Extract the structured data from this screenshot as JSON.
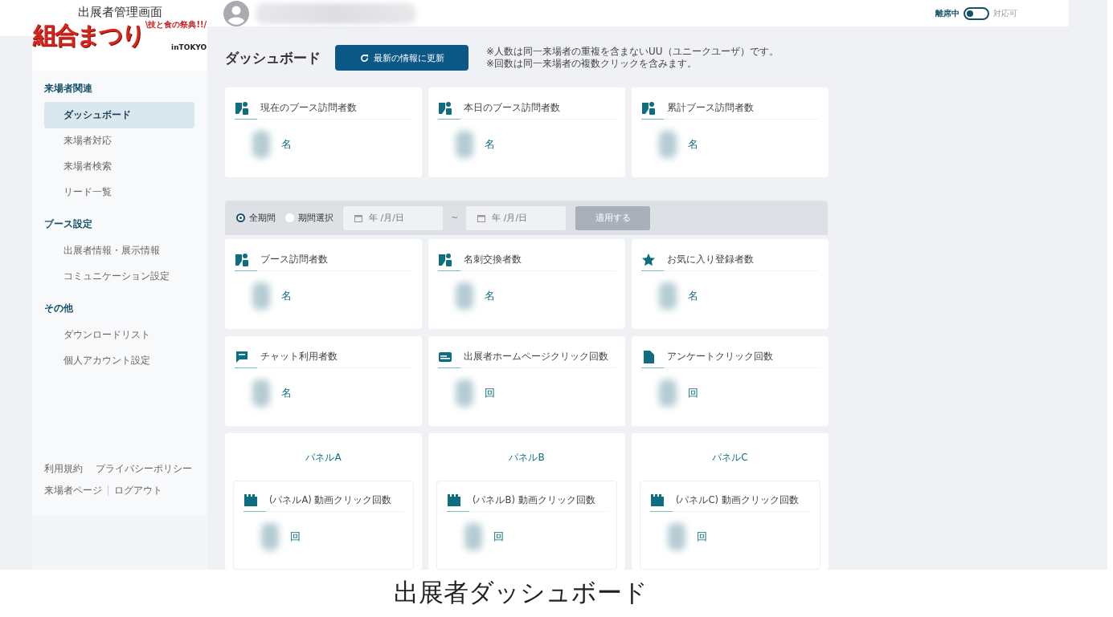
{
  "logo": {
    "caption": "出展者管理画面",
    "title": "組合まつり",
    "tagline": "\\技と食の祭典!!/",
    "subtitle": "inTOKYO"
  },
  "status_toggle": {
    "label_left": "離席中",
    "label_right": "対応可",
    "on": false
  },
  "sidebar": {
    "sections": [
      {
        "title": "来場者関連",
        "items": [
          {
            "label": "ダッシュボード",
            "selected": true
          },
          {
            "label": "来場者対応",
            "selected": false
          },
          {
            "label": "来場者検索",
            "selected": false
          },
          {
            "label": "リード一覧",
            "selected": false
          }
        ]
      },
      {
        "title": "ブース設定",
        "items": [
          {
            "label": "出展者情報・展示情報",
            "selected": false
          },
          {
            "label": "コミュニケーション設定",
            "selected": false
          }
        ]
      },
      {
        "title": "その他",
        "items": [
          {
            "label": "ダウンロードリスト",
            "selected": false
          },
          {
            "label": "個人アカウント設定",
            "selected": false
          }
        ]
      }
    ],
    "footer_rows": [
      {
        "links": [
          "利用規約",
          "プライバシーポリシー"
        ],
        "divider": false
      },
      {
        "links": [
          "来場者ページ",
          "ログアウト"
        ],
        "divider": true
      }
    ]
  },
  "page": {
    "title": "ダッシュボード",
    "refresh_button": "最新の情報に更新",
    "notes": [
      "※人数は同一来場者の重複を含まないUU（ユニークユーザ）です。",
      "※回数は同一来場者の複数クリックを含みます。"
    ]
  },
  "summary_cards": [
    {
      "kind": "visitors",
      "label": "現在のブース訪問者数",
      "unit": "名"
    },
    {
      "kind": "visitors",
      "label": "本日のブース訪問者数",
      "unit": "名"
    },
    {
      "kind": "visitors",
      "label": "累計ブース訪問者数",
      "unit": "名"
    }
  ],
  "filter": {
    "options": [
      {
        "label": "全期間",
        "selected": true
      },
      {
        "label": "期間選択",
        "selected": false
      }
    ],
    "date_from": {
      "placeholder": "年 /月/日"
    },
    "separator": "~",
    "date_to": {
      "placeholder": "年 /月/日"
    },
    "apply_button": {
      "label": "適用する",
      "disabled": true
    }
  },
  "stat_cards": [
    {
      "kind": "visitors",
      "label": "ブース訪問者数",
      "unit": "名"
    },
    {
      "kind": "visitors",
      "label": "名刺交換者数",
      "unit": "名"
    },
    {
      "kind": "favorites",
      "label": "お気に入り登録者数",
      "unit": "名"
    },
    {
      "kind": "chat",
      "label": "チャット利用者数",
      "unit": "名"
    },
    {
      "kind": "homepage",
      "label": "出展者ホームページクリック回数",
      "unit": "回"
    },
    {
      "kind": "survey",
      "label": "アンケートクリック回数",
      "unit": "回"
    }
  ],
  "panels": [
    {
      "title": "パネルA",
      "metric": "(パネルA) 動画クリック回数",
      "unit": "回"
    },
    {
      "title": "パネルB",
      "metric": "(パネルB) 動画クリック回数",
      "unit": "回"
    },
    {
      "title": "パネルC",
      "metric": "(パネルC) 動画クリック回数",
      "unit": "回"
    }
  ],
  "caption": "出展者ダッシュボード"
}
